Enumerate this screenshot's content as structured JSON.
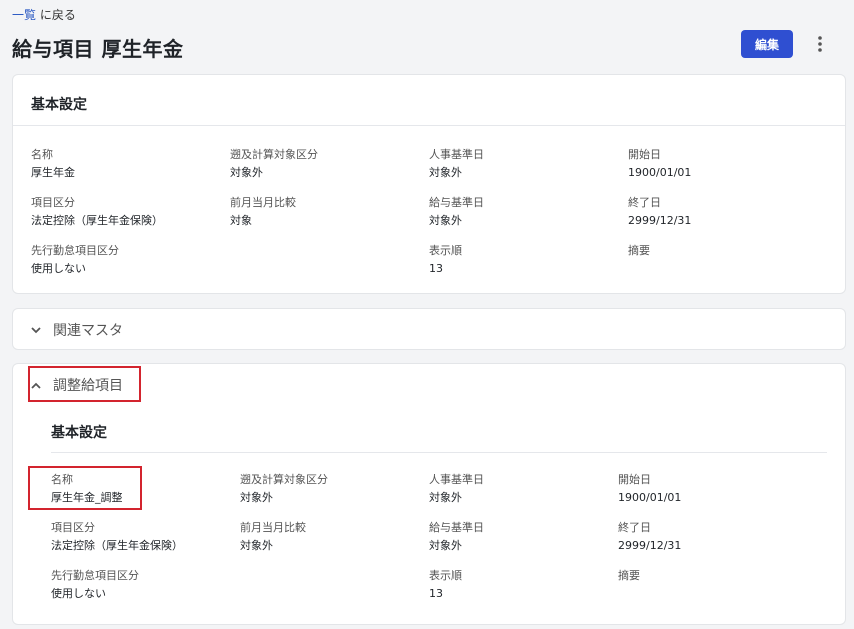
{
  "breadcrumb": {
    "link": "一覧",
    "rest": " に戻る"
  },
  "title": "給与項目 厚生年金",
  "edit_label": "編集",
  "basic": {
    "title": "基本設定",
    "fields": [
      {
        "label": "名称",
        "value": "厚生年金"
      },
      {
        "label": "遡及計算対象区分",
        "value": "対象外"
      },
      {
        "label": "人事基準日",
        "value": "対象外"
      },
      {
        "label": "開始日",
        "value": "1900/01/01"
      },
      {
        "label": "項目区分",
        "value": "法定控除（厚生年金保険）"
      },
      {
        "label": "前月当月比較",
        "value": "対象"
      },
      {
        "label": "給与基準日",
        "value": "対象外"
      },
      {
        "label": "終了日",
        "value": "2999/12/31"
      },
      {
        "label": "先行勤怠項目区分",
        "value": "使用しない"
      },
      {
        "label": "表示順",
        "value": "13"
      },
      {
        "label": "摘要",
        "value": ""
      }
    ]
  },
  "related": {
    "title": "関連マスタ"
  },
  "adjust": {
    "title": "調整給項目",
    "sub_title": "基本設定",
    "fields": [
      {
        "label": "名称",
        "value": "厚生年金_調整"
      },
      {
        "label": "遡及計算対象区分",
        "value": "対象外"
      },
      {
        "label": "人事基準日",
        "value": "対象外"
      },
      {
        "label": "開始日",
        "value": "1900/01/01"
      },
      {
        "label": "項目区分",
        "value": "法定控除（厚生年金保険）"
      },
      {
        "label": "前月当月比較",
        "value": "対象外"
      },
      {
        "label": "給与基準日",
        "value": "対象外"
      },
      {
        "label": "終了日",
        "value": "2999/12/31"
      },
      {
        "label": "先行勤怠項目区分",
        "value": "使用しない"
      },
      {
        "label": "表示順",
        "value": "13"
      },
      {
        "label": "摘要",
        "value": ""
      }
    ]
  },
  "colors": {
    "primary": "#2f4fd1",
    "highlight": "#d3242e",
    "link": "#2b59c3"
  },
  "icons": {
    "more": "more-vert-icon",
    "collapsed": "chevron-down-icon",
    "expanded": "chevron-up-icon"
  }
}
